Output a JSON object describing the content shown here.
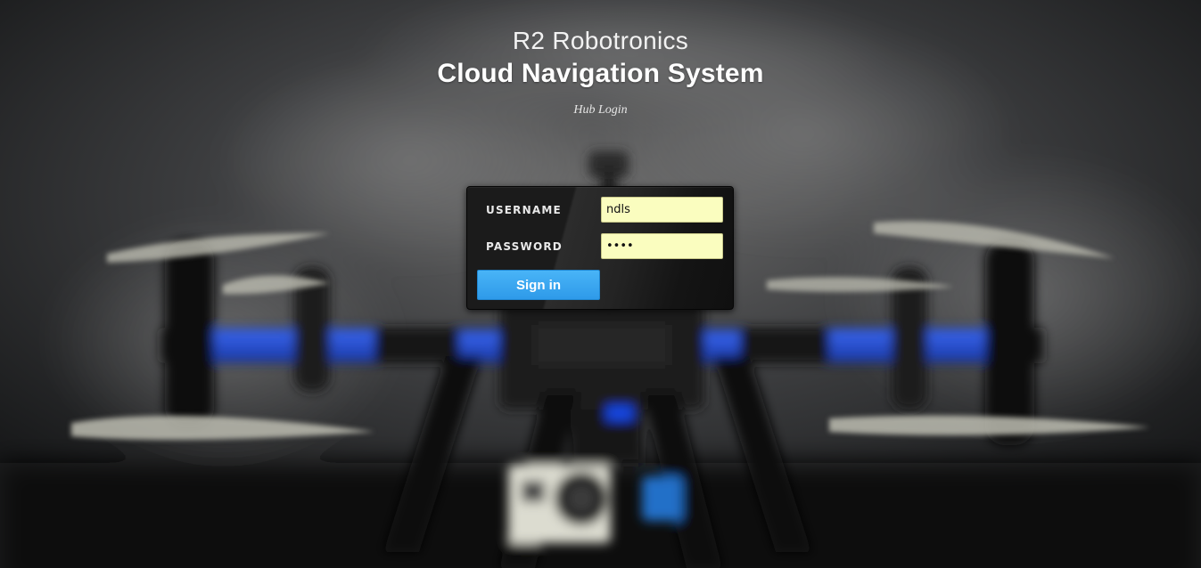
{
  "header": {
    "brand": "R2 Robotronics",
    "system_name": "Cloud Navigation System",
    "subtitle": "Hub Login"
  },
  "login_form": {
    "username_label": "USERNAME",
    "username_value": "ndls",
    "password_label": "PASSWORD",
    "password_value": "••••",
    "submit_label": "Sign in"
  },
  "colors": {
    "input_background": "#fafdbf",
    "button_accent": "#3ba6f0",
    "panel_background": "#1a1a1a",
    "drone_arm_blue": "#2452d8"
  }
}
